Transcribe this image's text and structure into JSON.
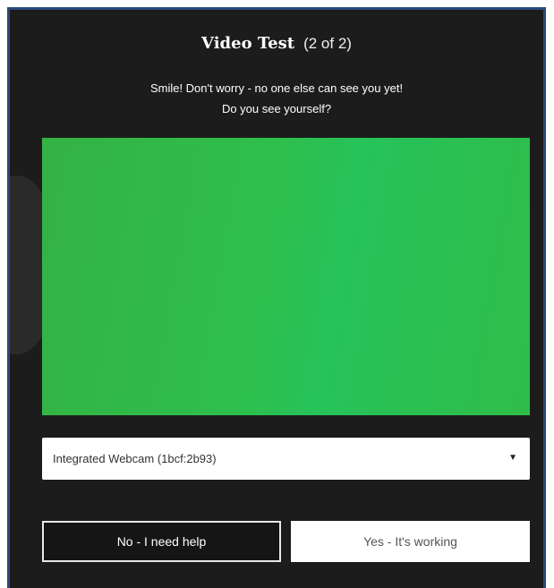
{
  "dialog": {
    "title": "Video Test",
    "step": "(2 of 2)",
    "subtitle_line1": "Smile! Don't worry - no one else can see you yet!",
    "subtitle_line2": "Do you see yourself?"
  },
  "camera_select": {
    "selected": "Integrated Webcam (1bcf:2b93)",
    "caret_icon": "chevron-down-icon"
  },
  "buttons": {
    "no_label": "No - I need help",
    "yes_label": "Yes - It's working"
  },
  "colors": {
    "dialog_bg": "#1c1c1c",
    "video_preview": "#2ebf4c",
    "frame_border": "#2a4a78"
  }
}
